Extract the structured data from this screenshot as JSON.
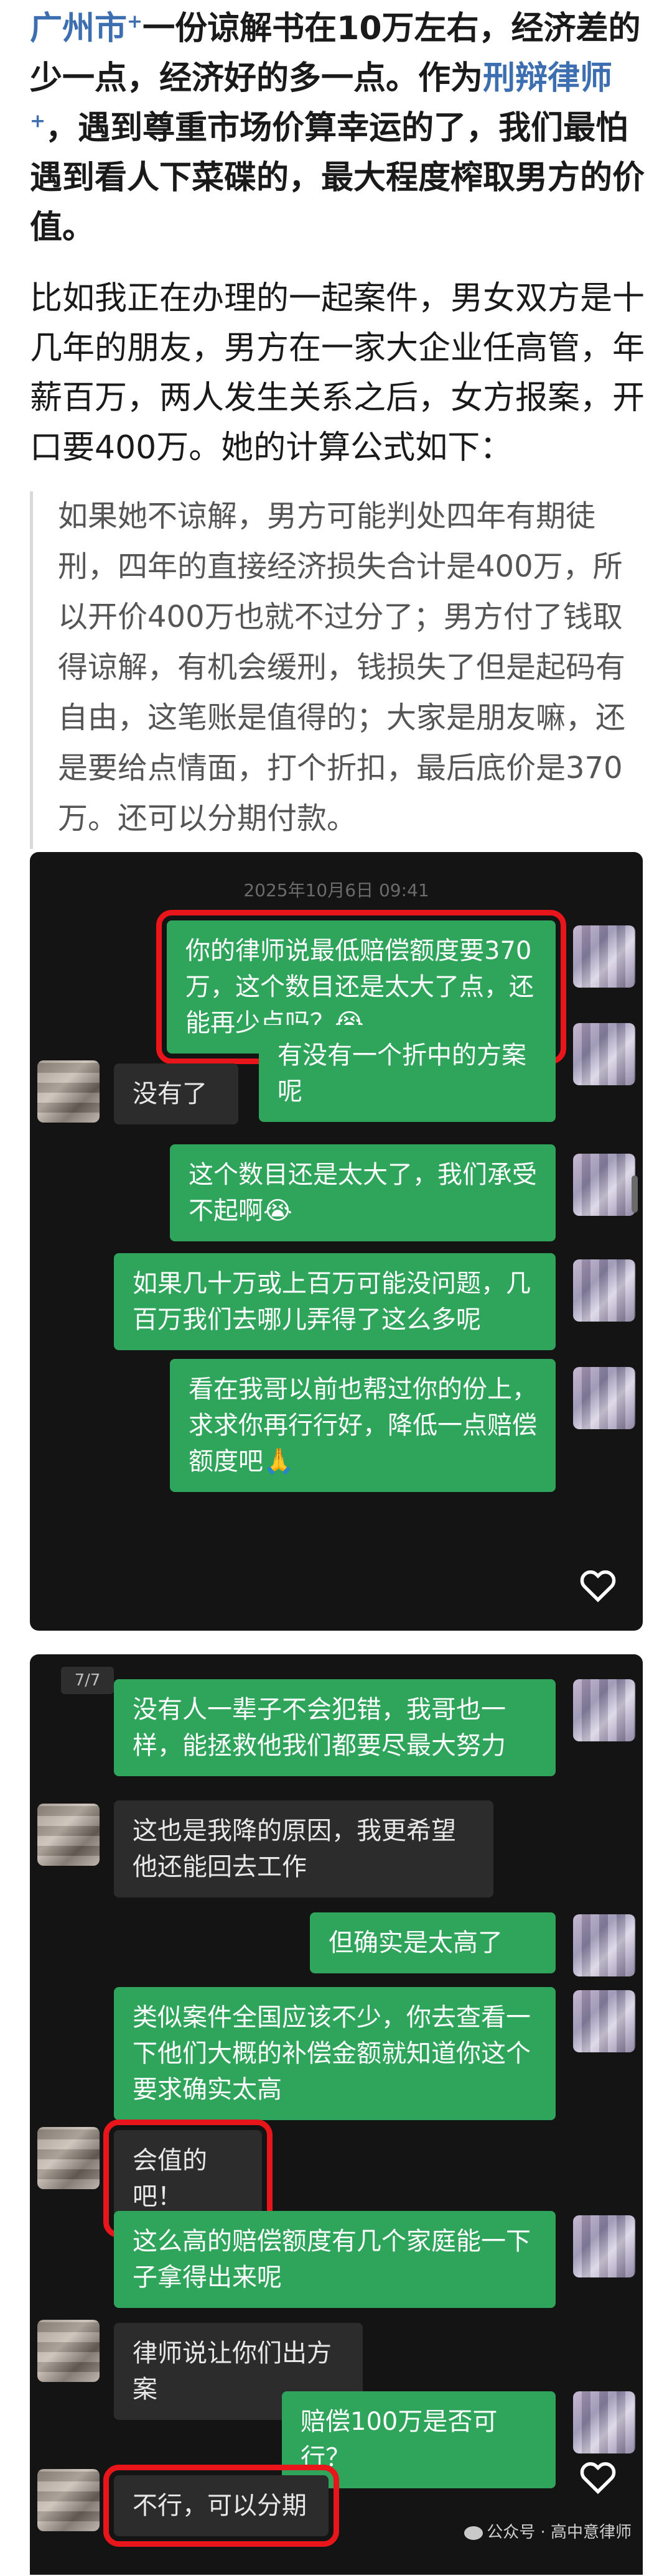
{
  "article": {
    "para1": {
      "city_link": "广州市",
      "part_a": "一份谅解书在10万左右，经济差的少一点，经济好的多一点。作为",
      "lawyer_link": "刑辩律师",
      "part_b": "，遇到尊重市场价算幸运的了，我们最怕遇到看人下菜碟的，最大程度榨取男方的价值。"
    },
    "para2": "比如我正在办理的一起案件，男女双方是十几年的朋友，男方在一家大企业任高管，年薪百万，两人发生关系之后，女方报案，开口要400万。她的计算公式如下：",
    "quote": "如果她不谅解，男方可能判处四年有期徒刑，四年的直接经济损失合计是400万，所以开价400万也就不过分了；男方付了钱取得谅解，有机会缓刑，钱损失了但是起码有自由，这笔账是值得的；大家是朋友嘛，还是要给点情面，打个折扣，最后底价是370万。还可以分期付款。"
  },
  "screenshot1": {
    "timestamp": "2025年10月6日 09:41",
    "messages": [
      {
        "side": "out",
        "text": "你的律师说最低赔偿额度要370万，这个数目还是太大了点，还能再少点吗？😭",
        "highlight": true
      },
      {
        "side": "out",
        "text": "有没有一个折中的方案呢"
      },
      {
        "side": "in",
        "text": "没有了"
      },
      {
        "side": "out",
        "text": "这个数目还是太大了，我们承受不起啊😭"
      },
      {
        "side": "out",
        "text": "如果几十万或上百万可能没问题，几百万我们去哪儿弄得了这么多呢"
      },
      {
        "side": "out",
        "text": "看在我哥以前也帮过你的份上，求求你再行行好，降低一点赔偿额度吧🙏"
      }
    ]
  },
  "screenshot2": {
    "page_badge": "7/7",
    "messages": [
      {
        "side": "out",
        "text": "没有人一辈子不会犯错，我哥也一样，能拯救他我们都要尽最大努力"
      },
      {
        "side": "in",
        "text": "这也是我降的原因，我更希望他还能回去工作"
      },
      {
        "side": "out",
        "text": "但确实是太高了"
      },
      {
        "side": "out",
        "text": "类似案件全国应该不少，你去查看一下他们大概的补偿金额就知道你这个要求确实太高"
      },
      {
        "side": "in",
        "text": "会值的吧！",
        "highlight": true
      },
      {
        "side": "out",
        "text": "这么高的赔偿额度有几个家庭能一下子拿得出来呢"
      },
      {
        "side": "in",
        "text": "律师说让你们出方案"
      },
      {
        "side": "out",
        "text": "赔偿100万是否可行？"
      },
      {
        "side": "in",
        "text": "不行，可以分期",
        "highlight": true
      }
    ],
    "watermark": "公众号 · 高中意律师"
  },
  "icons": {
    "like": "heart-icon",
    "sup": "link-marker-icon",
    "wechat": "wechat-icon"
  },
  "colors": {
    "link": "#3d6fb0",
    "bubble_out": "#2fa45b",
    "bubble_in": "#2c2c2c",
    "highlight": "#e8151a",
    "chat_bg": "#141414"
  }
}
